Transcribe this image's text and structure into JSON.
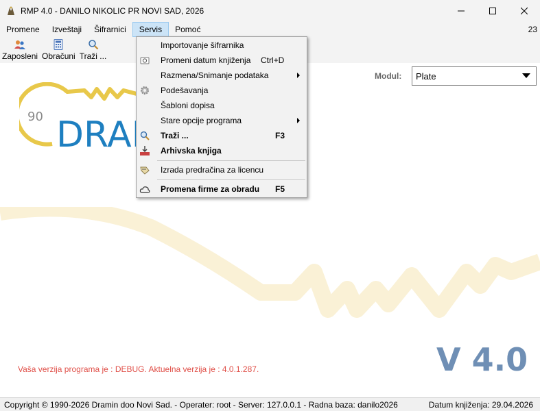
{
  "window": {
    "title": "RMP 4.0 - DANILO NIKOLIC PR NOVI SAD, 2026"
  },
  "menubar": {
    "items": [
      "Promene",
      "Izveštaji",
      "Šifrarnici",
      "Servis",
      "Pomoć"
    ],
    "active": "Servis",
    "right_value": "23"
  },
  "toolbar": {
    "buttons": [
      {
        "label": "Zaposleni",
        "icon": "users-icon"
      },
      {
        "label": "Obračuni",
        "icon": "calculator-icon"
      },
      {
        "label": "Traži ...",
        "icon": "search-icon"
      }
    ]
  },
  "servis_menu": {
    "items": [
      {
        "label": "Importovanje šifrarnika",
        "shortcut": "",
        "icon": "",
        "submenu": false,
        "bold": false
      },
      {
        "label": "Promeni datum knjiženja",
        "shortcut": "Ctrl+D",
        "icon": "calendar-icon",
        "submenu": false,
        "bold": false
      },
      {
        "label": "Razmena/Snimanje podataka",
        "shortcut": "",
        "icon": "",
        "submenu": true,
        "bold": false
      },
      {
        "label": "Podešavanja",
        "shortcut": "",
        "icon": "gear-icon",
        "submenu": false,
        "bold": false
      },
      {
        "label": "Šabloni dopisa",
        "shortcut": "",
        "icon": "",
        "submenu": false,
        "bold": false
      },
      {
        "label": "Stare opcije programa",
        "shortcut": "",
        "icon": "",
        "submenu": true,
        "bold": false
      },
      {
        "label": "Traži ...",
        "shortcut": "F3",
        "icon": "search-icon",
        "submenu": false,
        "bold": true
      },
      {
        "label": "Arhivska knjiga",
        "shortcut": "",
        "icon": "archive-icon",
        "submenu": false,
        "bold": true
      },
      {
        "label": "Izrada predračina za licencu",
        "shortcut": "",
        "icon": "license-icon",
        "submenu": false,
        "bold": false
      },
      {
        "label": "Promena firme za obradu",
        "shortcut": "F5",
        "icon": "cloud-icon",
        "submenu": false,
        "bold": true
      }
    ]
  },
  "module": {
    "label": "Modul:",
    "value": "Plate"
  },
  "logo": {
    "prefix": "90",
    "text": "DRAMIN"
  },
  "version": {
    "big": "V 4.0",
    "message": "Vaša verzija programa je : DEBUG. Aktuelna verzija je : 4.0.1.287."
  },
  "status": {
    "left": "Copyright © 1990-2026 Dramin doo Novi Sad. - Operater: root - Server: 127.0.0.1 - Radna baza: danilo2026",
    "right": "Datum knjiženja: 29.04.2026"
  },
  "colors": {
    "accent_blue": "#1e7fc0",
    "logo_yellow": "#e8c84a",
    "watermark": "#faf1d6",
    "version_blue": "#6f8fb5",
    "message_red": "#e0514a",
    "menu_highlight": "#cce4f7"
  }
}
